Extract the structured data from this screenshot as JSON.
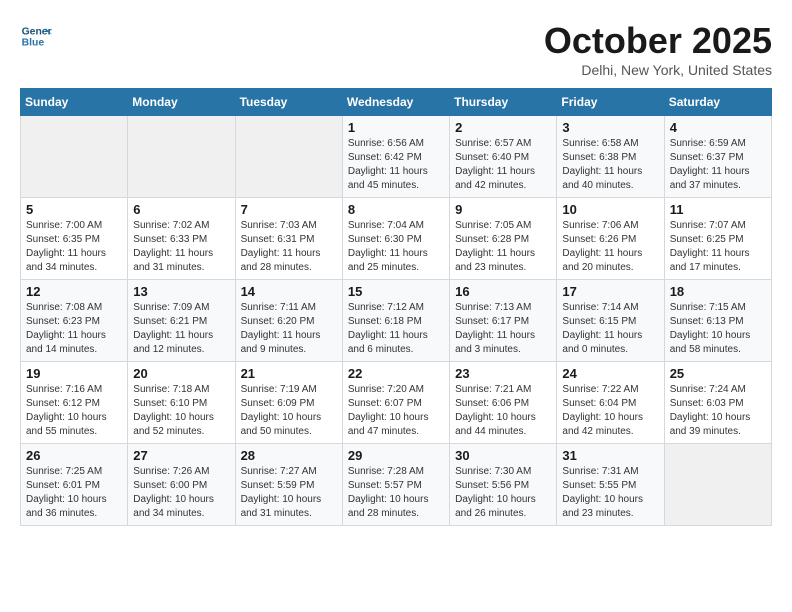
{
  "header": {
    "logo_line1": "General",
    "logo_line2": "Blue",
    "month": "October 2025",
    "location": "Delhi, New York, United States"
  },
  "days_of_week": [
    "Sunday",
    "Monday",
    "Tuesday",
    "Wednesday",
    "Thursday",
    "Friday",
    "Saturday"
  ],
  "weeks": [
    [
      {
        "day": "",
        "info": ""
      },
      {
        "day": "",
        "info": ""
      },
      {
        "day": "",
        "info": ""
      },
      {
        "day": "1",
        "info": "Sunrise: 6:56 AM\nSunset: 6:42 PM\nDaylight: 11 hours and 45 minutes."
      },
      {
        "day": "2",
        "info": "Sunrise: 6:57 AM\nSunset: 6:40 PM\nDaylight: 11 hours and 42 minutes."
      },
      {
        "day": "3",
        "info": "Sunrise: 6:58 AM\nSunset: 6:38 PM\nDaylight: 11 hours and 40 minutes."
      },
      {
        "day": "4",
        "info": "Sunrise: 6:59 AM\nSunset: 6:37 PM\nDaylight: 11 hours and 37 minutes."
      }
    ],
    [
      {
        "day": "5",
        "info": "Sunrise: 7:00 AM\nSunset: 6:35 PM\nDaylight: 11 hours and 34 minutes."
      },
      {
        "day": "6",
        "info": "Sunrise: 7:02 AM\nSunset: 6:33 PM\nDaylight: 11 hours and 31 minutes."
      },
      {
        "day": "7",
        "info": "Sunrise: 7:03 AM\nSunset: 6:31 PM\nDaylight: 11 hours and 28 minutes."
      },
      {
        "day": "8",
        "info": "Sunrise: 7:04 AM\nSunset: 6:30 PM\nDaylight: 11 hours and 25 minutes."
      },
      {
        "day": "9",
        "info": "Sunrise: 7:05 AM\nSunset: 6:28 PM\nDaylight: 11 hours and 23 minutes."
      },
      {
        "day": "10",
        "info": "Sunrise: 7:06 AM\nSunset: 6:26 PM\nDaylight: 11 hours and 20 minutes."
      },
      {
        "day": "11",
        "info": "Sunrise: 7:07 AM\nSunset: 6:25 PM\nDaylight: 11 hours and 17 minutes."
      }
    ],
    [
      {
        "day": "12",
        "info": "Sunrise: 7:08 AM\nSunset: 6:23 PM\nDaylight: 11 hours and 14 minutes."
      },
      {
        "day": "13",
        "info": "Sunrise: 7:09 AM\nSunset: 6:21 PM\nDaylight: 11 hours and 12 minutes."
      },
      {
        "day": "14",
        "info": "Sunrise: 7:11 AM\nSunset: 6:20 PM\nDaylight: 11 hours and 9 minutes."
      },
      {
        "day": "15",
        "info": "Sunrise: 7:12 AM\nSunset: 6:18 PM\nDaylight: 11 hours and 6 minutes."
      },
      {
        "day": "16",
        "info": "Sunrise: 7:13 AM\nSunset: 6:17 PM\nDaylight: 11 hours and 3 minutes."
      },
      {
        "day": "17",
        "info": "Sunrise: 7:14 AM\nSunset: 6:15 PM\nDaylight: 11 hours and 0 minutes."
      },
      {
        "day": "18",
        "info": "Sunrise: 7:15 AM\nSunset: 6:13 PM\nDaylight: 10 hours and 58 minutes."
      }
    ],
    [
      {
        "day": "19",
        "info": "Sunrise: 7:16 AM\nSunset: 6:12 PM\nDaylight: 10 hours and 55 minutes."
      },
      {
        "day": "20",
        "info": "Sunrise: 7:18 AM\nSunset: 6:10 PM\nDaylight: 10 hours and 52 minutes."
      },
      {
        "day": "21",
        "info": "Sunrise: 7:19 AM\nSunset: 6:09 PM\nDaylight: 10 hours and 50 minutes."
      },
      {
        "day": "22",
        "info": "Sunrise: 7:20 AM\nSunset: 6:07 PM\nDaylight: 10 hours and 47 minutes."
      },
      {
        "day": "23",
        "info": "Sunrise: 7:21 AM\nSunset: 6:06 PM\nDaylight: 10 hours and 44 minutes."
      },
      {
        "day": "24",
        "info": "Sunrise: 7:22 AM\nSunset: 6:04 PM\nDaylight: 10 hours and 42 minutes."
      },
      {
        "day": "25",
        "info": "Sunrise: 7:24 AM\nSunset: 6:03 PM\nDaylight: 10 hours and 39 minutes."
      }
    ],
    [
      {
        "day": "26",
        "info": "Sunrise: 7:25 AM\nSunset: 6:01 PM\nDaylight: 10 hours and 36 minutes."
      },
      {
        "day": "27",
        "info": "Sunrise: 7:26 AM\nSunset: 6:00 PM\nDaylight: 10 hours and 34 minutes."
      },
      {
        "day": "28",
        "info": "Sunrise: 7:27 AM\nSunset: 5:59 PM\nDaylight: 10 hours and 31 minutes."
      },
      {
        "day": "29",
        "info": "Sunrise: 7:28 AM\nSunset: 5:57 PM\nDaylight: 10 hours and 28 minutes."
      },
      {
        "day": "30",
        "info": "Sunrise: 7:30 AM\nSunset: 5:56 PM\nDaylight: 10 hours and 26 minutes."
      },
      {
        "day": "31",
        "info": "Sunrise: 7:31 AM\nSunset: 5:55 PM\nDaylight: 10 hours and 23 minutes."
      },
      {
        "day": "",
        "info": ""
      }
    ]
  ]
}
